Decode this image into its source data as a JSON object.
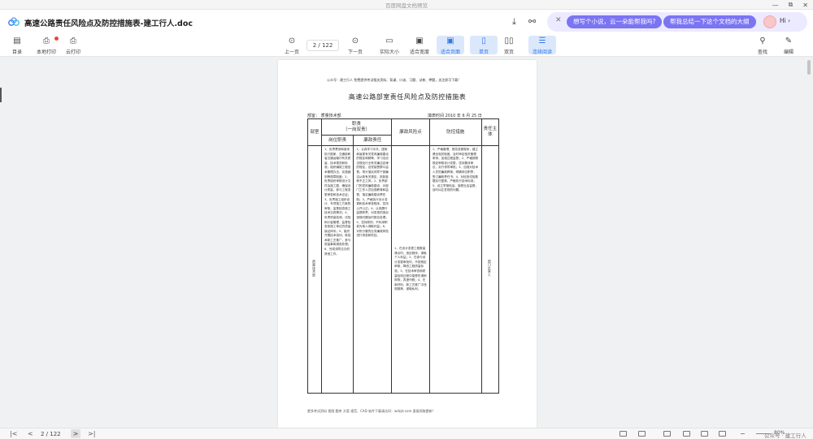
{
  "window": {
    "title": "百度网盘文档预览",
    "controls": [
      "—",
      "⧉",
      "✕"
    ]
  },
  "header": {
    "doc_title": "高速公路责任风险点及防控措施表-建工行人.doc",
    "download_icon": "download-icon",
    "share_icon": "share-icon"
  },
  "ai_bar": {
    "close": "✕",
    "prompt1": "想写个小说，云一朵能帮我吗?",
    "prompt2": "帮我总结一下这个文档的大纲",
    "greeting": "Hi ›"
  },
  "toolbar": {
    "catalog": "目录",
    "local_print": "本地打印",
    "cloud_print": "云打印",
    "prev_page": "上一页",
    "page_indicator": "2 / 122",
    "next_page": "下一页",
    "actual_size": "实际大小",
    "fit_width": "适合宽度",
    "fit_page": "适合页面",
    "single_page": "单页",
    "double_page": "双页",
    "continuous": "连续阅读",
    "find": "查找",
    "edit": "编辑"
  },
  "document": {
    "top_line": "公众号：建工行人  免费提供考试相关资料、背诵、口诀、习题、试卷、押题，关注即可下载!",
    "title": "高速公路部室责任风险点及防控措施表",
    "dept": "部室：  质量技术部",
    "date": "填表时间   2010 年  6 月  25 日",
    "table": {
      "h_dept": "部室",
      "h_duty": "职责",
      "h_duty_sub": "（一岗双责）",
      "h_post_duty": "岗位职责",
      "h_clean_duty": "廉政责任",
      "h_risk": "廉政风险点",
      "h_measures": "防控措施",
      "h_subject": "责任主体",
      "dept_name": "质量技术部",
      "post_duty": "1、负责贯彻和宣传执行国家、交通部和省交通运输厅有关质量、技术规范和标准；组织编制工程技术管理办法、实施细则等规章制度；2、负责组织审核设计文件及施工图，确保设计质量，参与工程变更审查和技术论证；3、负责施工组织设计、专项施工方案的审核，监督检查施工技术交底情况；4、负责质量检测、试验和计量管理，监督检查各施工单位的质量保证体系；5、组织开展技术培训、新技术新工艺推广，参与质量事故调查处理；6、完成领导交办的其他工作。",
      "clean_duty": "1、认真学习中共、国家和省委有关党风廉政建设的规定和精神，学习法纪法规及行业有关廉洁自律的规定，自觉接受群众监督，带头落实领导干部廉洁从政有关规定，抵制各种不正之风；2、负责部门的党风廉政建设，对部门工作人员加强教育和监督，落实廉政建设责任制；3、严格执行设计变更和技术审查程序，坚持公开公正；4、认真履行监督职责，对发现的违纪违规问题及时报告处理；5、坚持原则，不利用职权为他人谋取利益；6、对所分管的业务廉政风险进行排查和防控。",
      "risk": "1、在设计变更工程数量清点时，违反程序，谋取个人利益；2、在参与设计变更审批时，不按规定审核，降低工程质量标准；3、在技术审查和质量检测过程中接受吃请和财物，弄虚作假；4、在新材料、新工艺推广中违规推荐，谋取私利。",
      "measures": "1、严格管理，规范变更程序，建立健全相关制度，及时审定相关管理条例，加强过程监督；2、严格按照规定审核设计变更，坚持集体审议，实行领导审批；3、加强对技术人员的廉政教育，明确岗位职责，签订廉政责任书；4、对检测试验数据实行复核，严格执行技术标准；5、设立举报电话，接受社会监督，及时纠正发现的问题。",
      "subject": "部门负责人"
    },
    "footer": "更多考试资料 视频 题库 方案 规范、CAD 软件下载请访问：wdzjd.com 直接领取更新!"
  },
  "bottom": {
    "first": "|<",
    "prev": "<",
    "page_indicator": "2 / 122",
    "next": ">",
    "last": ">|",
    "zoom": "80%",
    "watermark": "公众号 · 建工行人"
  }
}
